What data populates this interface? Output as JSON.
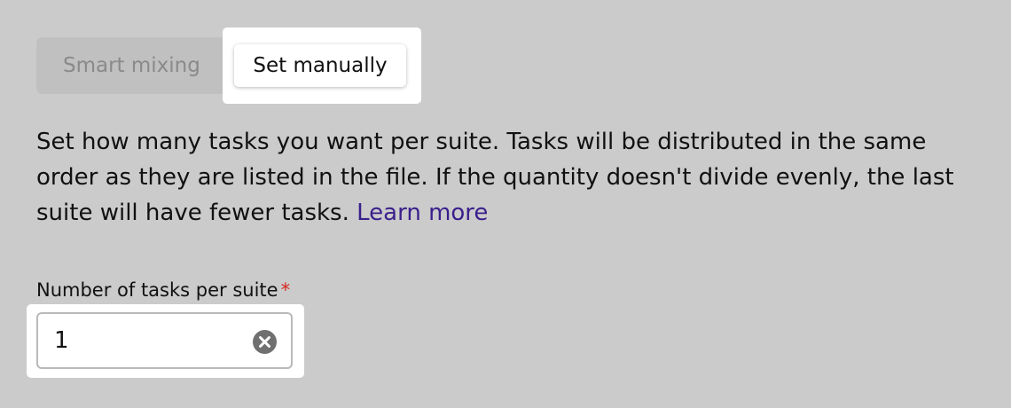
{
  "mode_switch": {
    "smart_label": "Smart mixing",
    "manual_label": "Set manually",
    "selected": "Set manually"
  },
  "description": {
    "text": "Set how many tasks you want per suite. Tasks will be distributed in the same order as they are listed in the file. If the quantity doesn't divide evenly, the last suite will have fewer tasks. ",
    "link_label": "Learn more"
  },
  "field": {
    "label": "Number of tasks per suite",
    "required_mark": "*",
    "value": "1",
    "clear_icon": "clear-circle-icon"
  },
  "colors": {
    "background": "#cbcbcb",
    "highlight": "#ffffff",
    "link": "#3a1f8c",
    "required": "#d6261f",
    "icon": "#707070"
  }
}
